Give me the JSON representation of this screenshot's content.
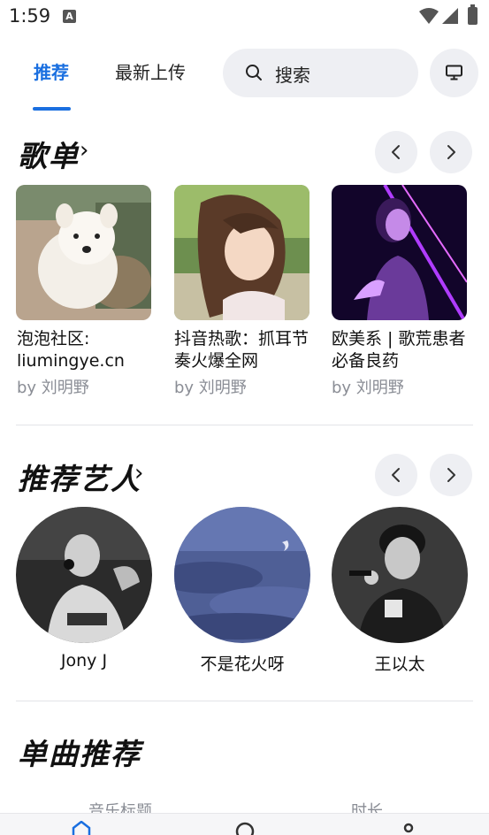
{
  "status": {
    "time": "1:59",
    "notification_icon": "A"
  },
  "tabs": [
    {
      "label": "推荐",
      "active": true
    },
    {
      "label": "最新上传",
      "active": false
    }
  ],
  "search": {
    "placeholder": "搜索"
  },
  "sections": {
    "playlists": {
      "title": "歌单"
    },
    "artists": {
      "title": "推荐艺人"
    },
    "songs": {
      "title": "单曲推荐"
    }
  },
  "playlists": [
    {
      "title": "泡泡社区: liumingye.cn",
      "by": "by 刘明野"
    },
    {
      "title": "抖音热歌：抓耳节奏火爆全网",
      "by": "by 刘明野"
    },
    {
      "title": "欧美系 | 歌荒患者必备良药",
      "by": "by 刘明野"
    }
  ],
  "artists": [
    {
      "name": "Jony J"
    },
    {
      "name": "不是花火呀"
    },
    {
      "name": "王以太"
    }
  ],
  "song_table": {
    "columns": [
      "音乐标题",
      "时长"
    ]
  },
  "colors": {
    "accent": "#1a6fe0",
    "button_bg": "#eeeff3",
    "muted_text": "#8a8d95"
  }
}
